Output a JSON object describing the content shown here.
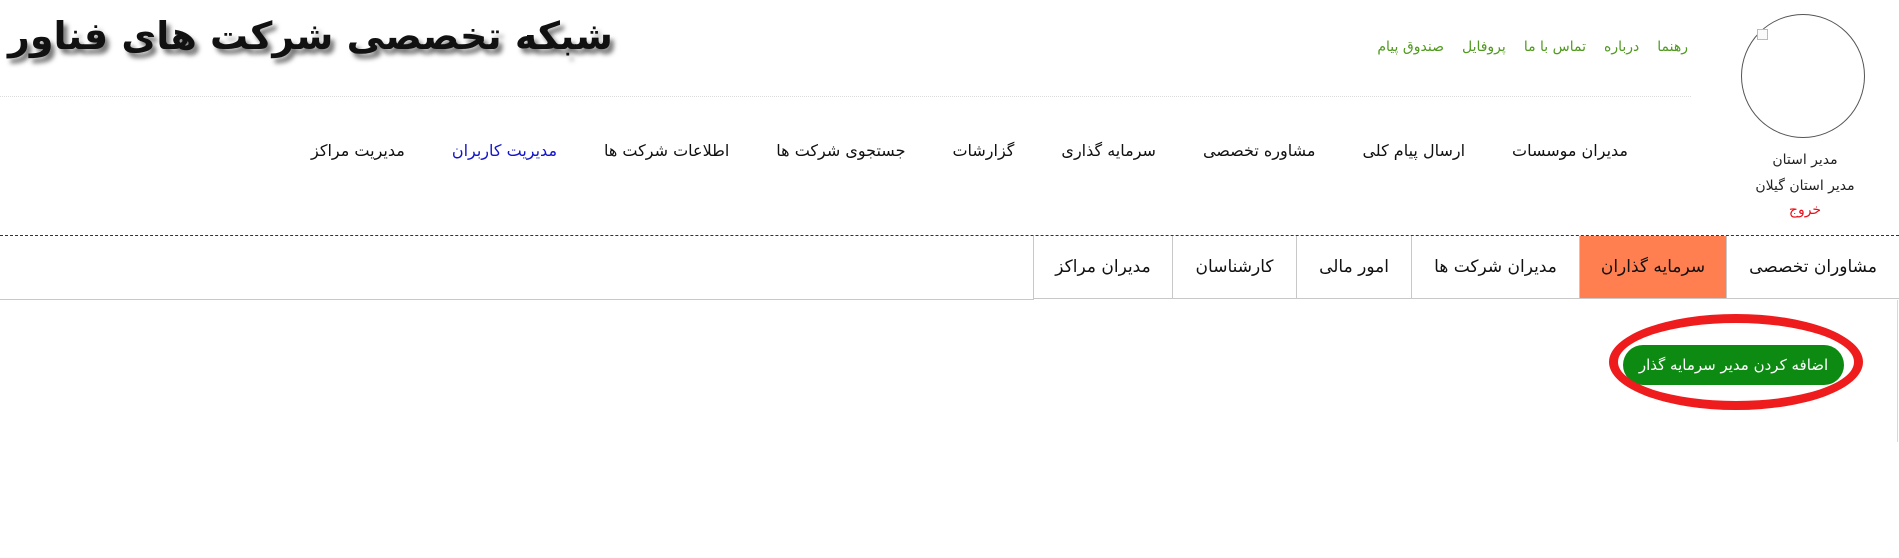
{
  "header": {
    "site_title": "شبکه تخصصی شرکت های فناور",
    "top_links": [
      "صندوق پیام",
      "پروفایل",
      "تماس با ما",
      "درباره",
      "رهنما"
    ]
  },
  "user": {
    "role": "مدیر استان",
    "name": "مدیر استان گیلان",
    "logout_label": "خروج",
    "logout_color": "#e8101a"
  },
  "main_nav": {
    "items": [
      {
        "label": "مدیریت مراکز"
      },
      {
        "label": "مدیریت کاربران",
        "active": true
      },
      {
        "label": "اطلاعات شرکت ها"
      },
      {
        "label": "جستجوی شرکت ها"
      },
      {
        "label": "گزارشات"
      },
      {
        "label": "سرمایه گذاری"
      },
      {
        "label": "مشاوره تخصصی"
      },
      {
        "label": "ارسال پیام کلی"
      },
      {
        "label": "مدیران موسسات"
      }
    ]
  },
  "tabs": {
    "items": [
      {
        "label": "مدیران مراکز"
      },
      {
        "label": "کارشناسان"
      },
      {
        "label": "امور مالی"
      },
      {
        "label": "مدیران شرکت ها"
      },
      {
        "label": "سرمایه گذاران",
        "active": true
      },
      {
        "label": "مشاوران تخصصی"
      }
    ]
  },
  "actions": {
    "add_investor_manager_label": "اضافه کردن مدیر سرمایه گذار"
  },
  "colors": {
    "top_link": "#4f9a1f",
    "active_nav": "#1414c8",
    "active_tab": "#ff7f50",
    "add_button": "#0c8a12",
    "highlight_ring": "#ee1c1c"
  }
}
